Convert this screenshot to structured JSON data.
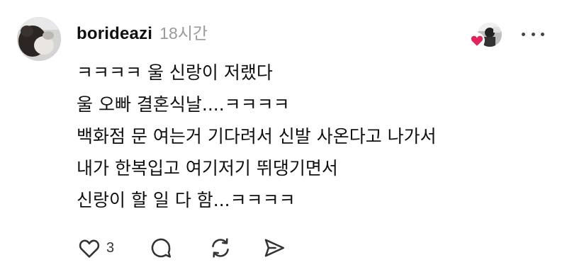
{
  "post": {
    "author": "borideazi",
    "time_ago": "18시간",
    "lines": [
      "ㅋㅋㅋㅋ 울 신랑이 저랬다",
      "울 오빠 결혼식날....ㅋㅋㅋㅋ",
      "백화점 문 여는거 기다려서 신발 사온다고 나가서",
      "내가 한복입고 여기저기 뛰댕기면서",
      "신랑이 할 일 다 함...ㅋㅋㅋㅋ"
    ],
    "like_count": "3"
  },
  "colors": {
    "heart_red": "#e0245e",
    "muted": "#9a9a9a",
    "text": "#101010",
    "icon": "#333333"
  },
  "icons": {
    "more": "more-dots-icon",
    "like": "heart-outline-icon",
    "comment": "comment-bubble-icon",
    "repost": "repost-icon",
    "share": "send-icon"
  }
}
